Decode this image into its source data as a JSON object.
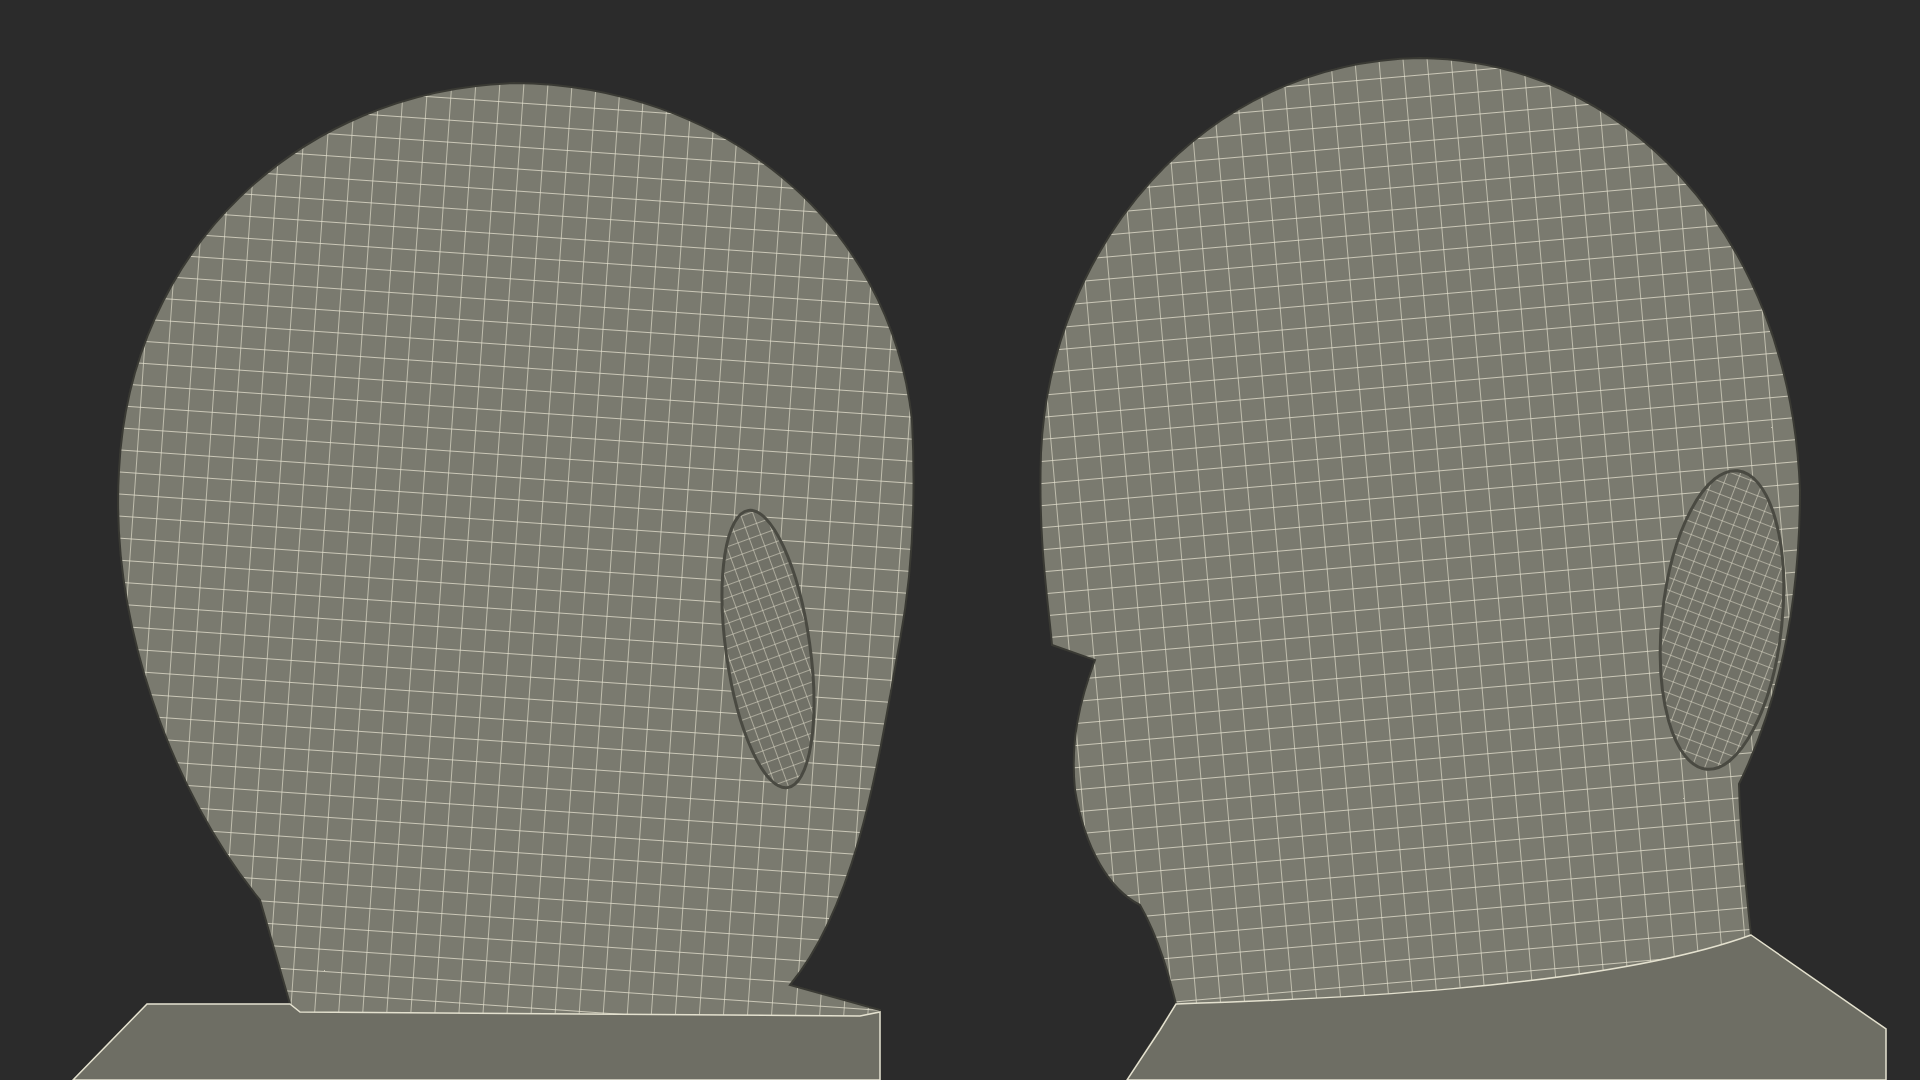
{
  "scene": {
    "views": [
      {
        "kind": "back"
      },
      {
        "kind": "front"
      }
    ]
  }
}
